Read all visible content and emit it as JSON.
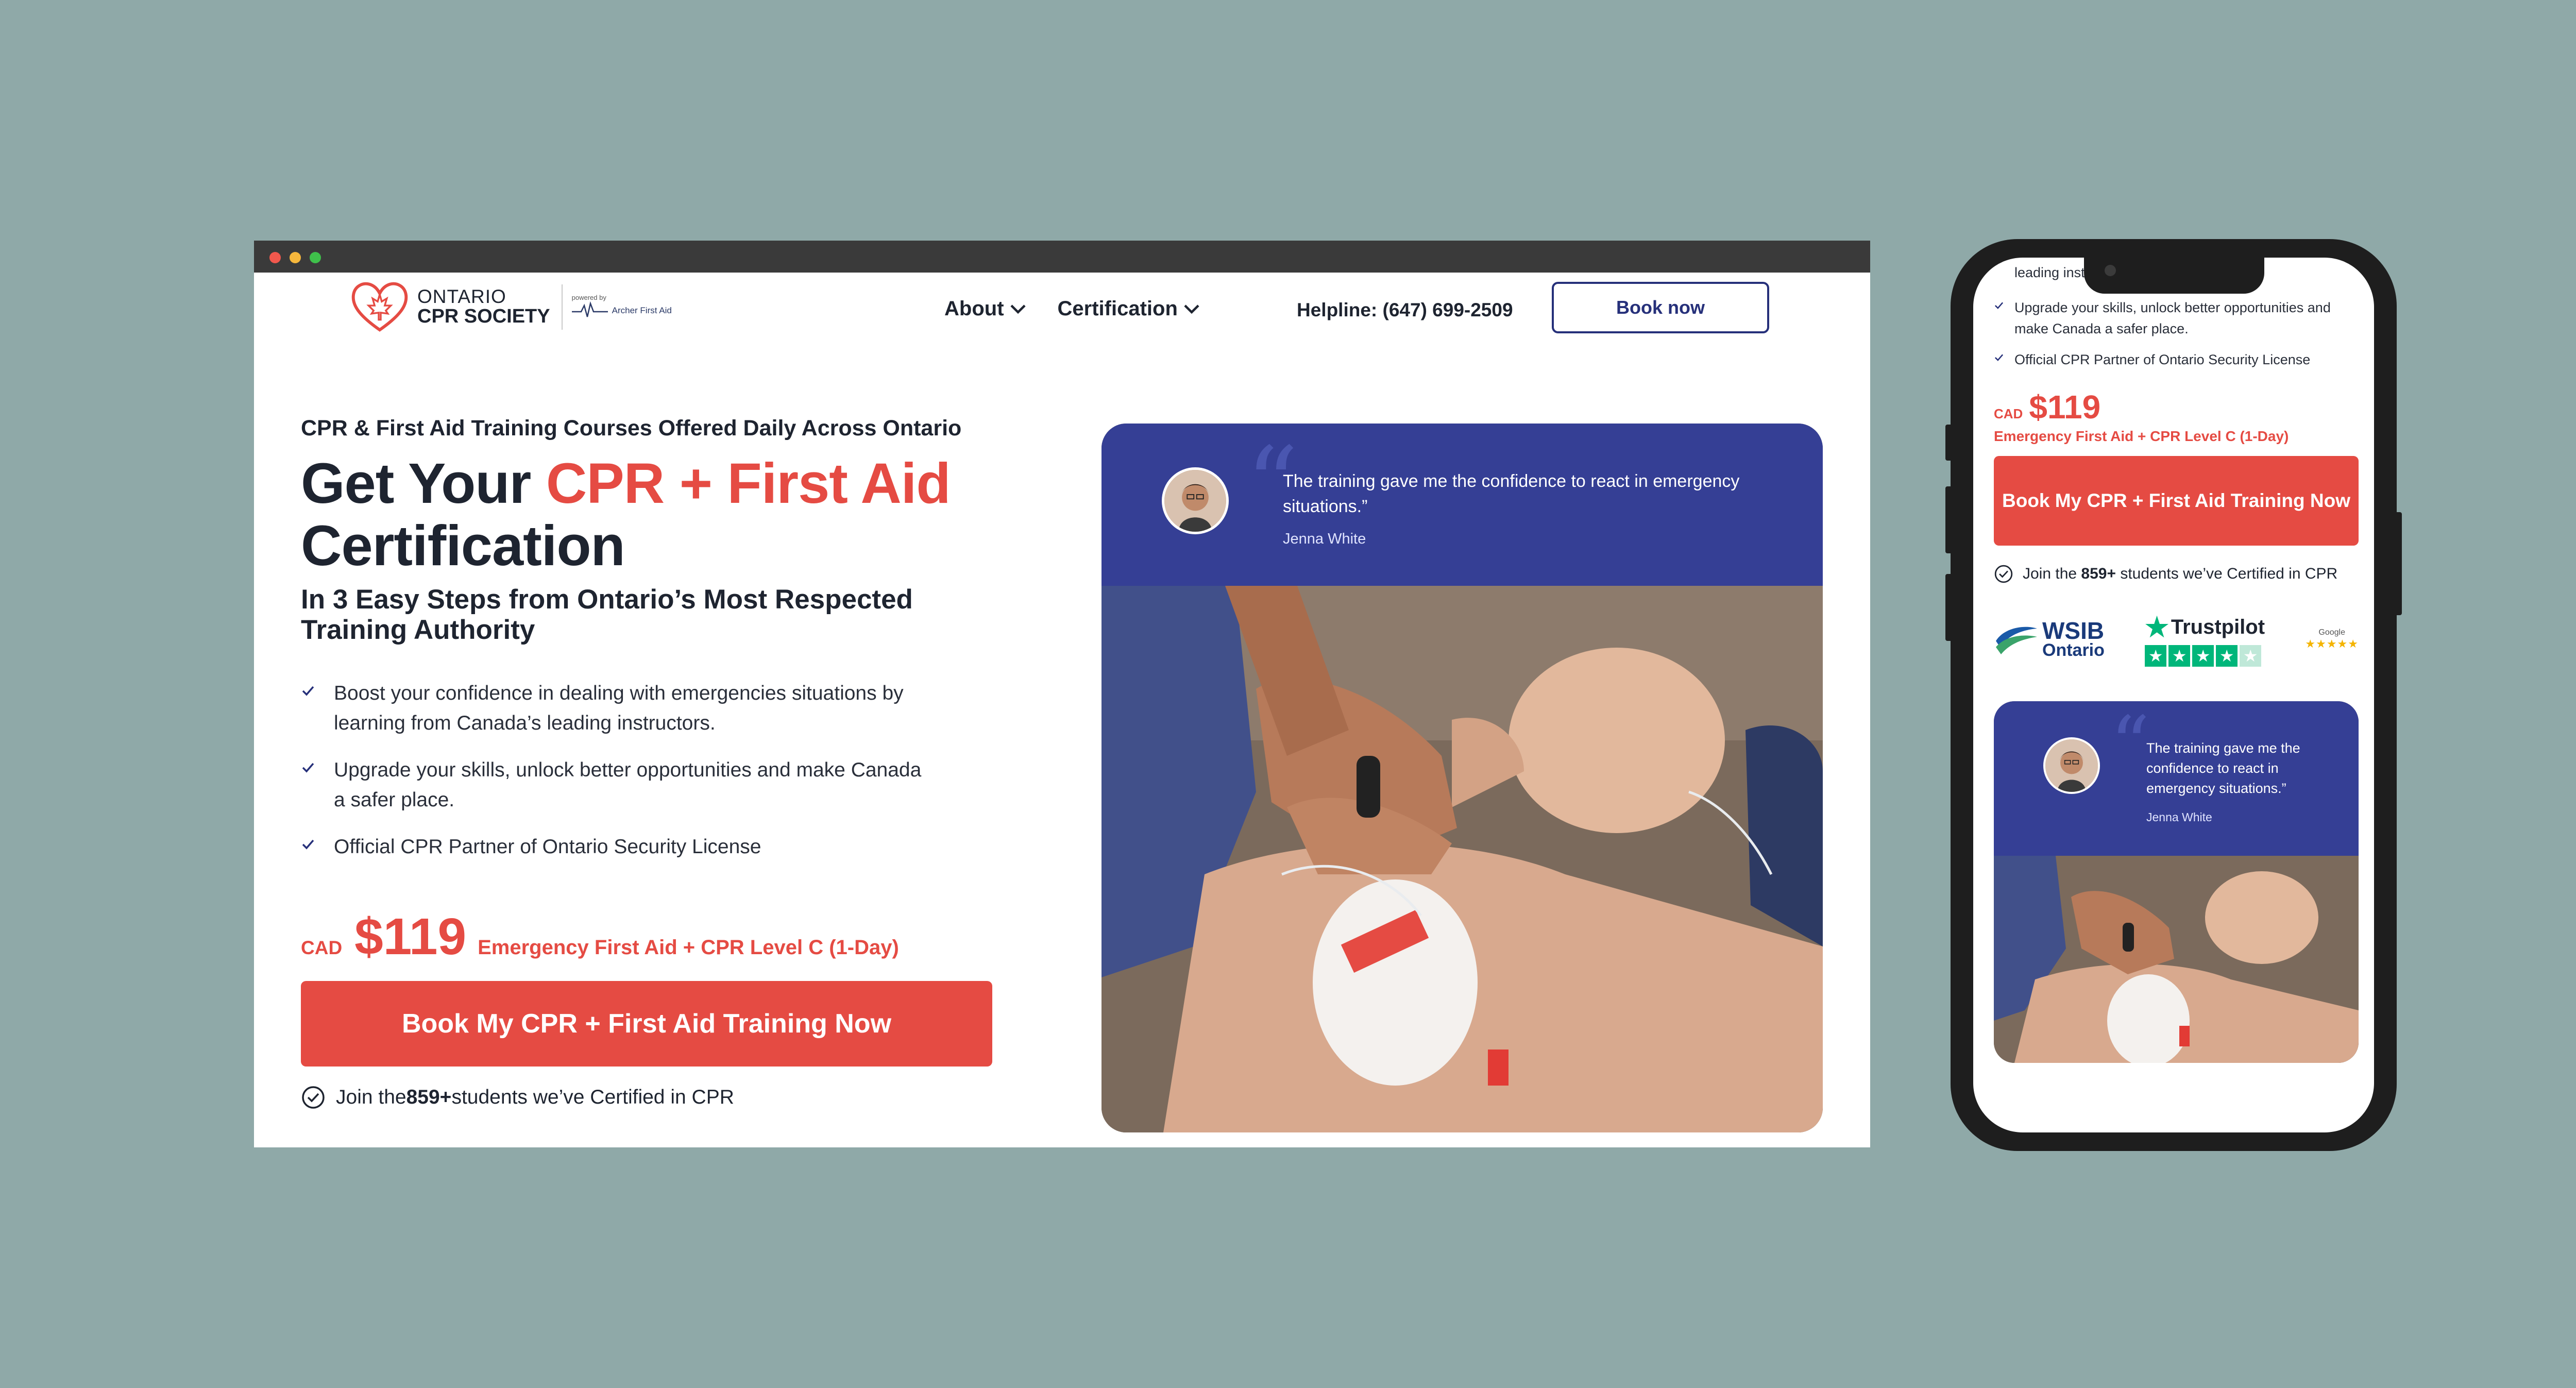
{
  "desktop": {
    "header": {
      "logo": {
        "line1": "ONTARIO",
        "line2": "CPR SOCIETY",
        "powered_by": "powered by",
        "partner": "Archer First Aid"
      },
      "nav": [
        {
          "label": "About"
        },
        {
          "label": "Certification"
        }
      ],
      "helpline": "Helpline: (647) 699-2509",
      "book_now": "Book now"
    },
    "hero": {
      "eyebrow": "CPR & First Aid Training Courses Offered Daily Across Ontario",
      "title_pre": "Get Your ",
      "title_accent": "CPR + First Aid",
      "title_post": "Certification",
      "subtitle": "In 3 Easy Steps from Ontario’s Most Respected Training Authority",
      "bullets": [
        "Boost your confidence in dealing with emergencies situations by learning from Canada’s leading instructors.",
        "Upgrade your skills, unlock better opportunities and make Canada a safer place.",
        "Official CPR Partner of Ontario Security License"
      ],
      "currency": "CAD",
      "price": "$119",
      "price_desc": "Emergency First Aid + CPR Level C (1-Day)",
      "cta": "Book My CPR + First Aid Training Now",
      "join_pre": "Join the ",
      "join_count": "859+",
      "join_post": " students we’ve Certified in CPR"
    },
    "testimonial": {
      "quote": "The training gave me the confidence to react in emergency situations.”",
      "name": "Jenna White"
    }
  },
  "mobile": {
    "partial_top": "leading inst",
    "bullets": [
      "Upgrade your skills, unlock better opportunities and make Canada a safer place.",
      "Official CPR Partner of Ontario Security License"
    ],
    "currency": "CAD",
    "price": "$119",
    "price_desc": "Emergency First Aid + CPR Level C (1-Day)",
    "cta": "Book My CPR + First Aid Training Now",
    "join_pre": "Join the ",
    "join_count": "859+",
    "join_post": " students we’ve Certified in CPR",
    "badges": {
      "wsib_line1": "WSIB",
      "wsib_line2": "Ontario",
      "trustpilot": "Trustpilot",
      "trustpilot_stars": 4.5,
      "google": "Google"
    },
    "testimonial": {
      "quote": "The training gave me the confidence to react in emergency situations.”",
      "name": "Jenna White"
    }
  },
  "colors": {
    "accent": "#e54b43",
    "brand_navy": "#26307a",
    "testimonial_bg": "#353f95",
    "page_bg": "#8fa9a8"
  }
}
